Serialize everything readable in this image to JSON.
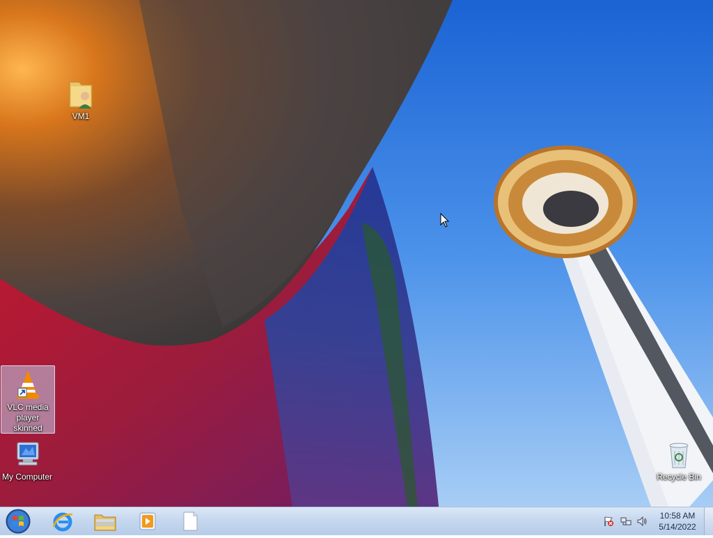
{
  "desktop": {
    "icons": [
      {
        "label": "VM1"
      },
      {
        "label": "VLC media player skinned"
      },
      {
        "label": "My Computer"
      },
      {
        "label": "Recycle Bin"
      }
    ]
  },
  "taskbar": {
    "start_icon": "windows-start-orb",
    "pinned": [
      {
        "icon": "internet-explorer-icon"
      },
      {
        "icon": "file-explorer-icon"
      },
      {
        "icon": "media-player-icon"
      },
      {
        "icon": "blank-document-icon"
      }
    ],
    "tray": {
      "icons": [
        "action-center-flag-icon",
        "network-icon",
        "volume-icon"
      ],
      "time": "10:58 AM",
      "date": "5/14/2022"
    }
  },
  "colors": {
    "sky": "#3d86e6",
    "taskbar": "#c6d8ef"
  }
}
